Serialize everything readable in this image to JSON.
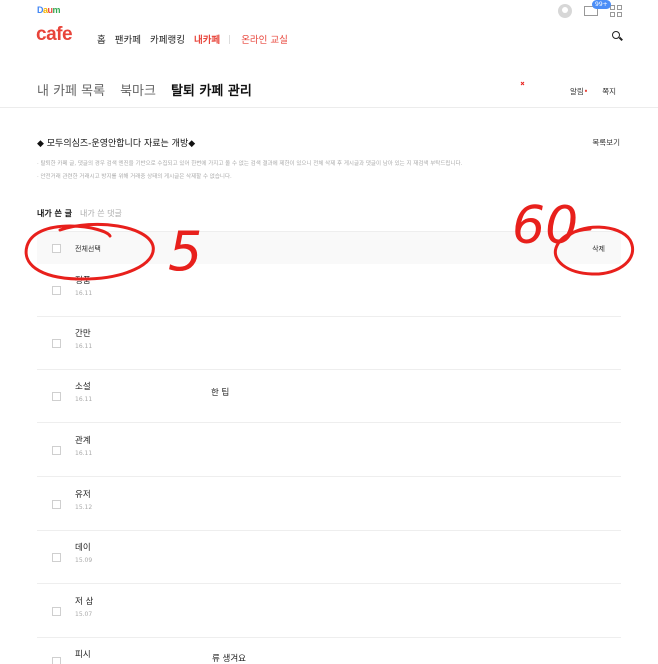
{
  "header": {
    "daum_letters": [
      "D",
      "a",
      "u",
      "m"
    ],
    "cafe_logo": "cafe",
    "mail_badge": "99+",
    "nav": [
      "홈",
      "팬카페",
      "카페랭킹",
      "내카페",
      "온라인 교실"
    ]
  },
  "tabs": [
    "내 카페 목록",
    "북마크",
    "탈퇴 카페 관리"
  ],
  "tab_right": {
    "alarm": "알림",
    "alarm_dot": "•",
    "note": "쪽지"
  },
  "cafe": {
    "title": "◆ 모두의심즈-운영안합니다 자료는 개방◆",
    "list_view": "목록보기",
    "notices": [
      "· 탈퇴한 카페 글, 댓글의 경우 검색 엔진을 기반으로 수집되고 있어 한번에 가지고 올 수 없는 검색 결과에 제한이 있으니 전체 삭제 후 게시글과 댓글이 남아 있는 지 재검색 부탁드립니다.",
      "· 안전거래 관련한 거래시고 방지를 위해 거래중 상태의 게시글은 삭제할 수 없습니다."
    ]
  },
  "subtabs": {
    "posts": "내가 쓴 글",
    "comments": "내가 쓴 댓글"
  },
  "table": {
    "select_all": "전체선택",
    "delete": "삭제",
    "rows": [
      {
        "title": "정품",
        "date": "16.11"
      },
      {
        "title": "간만",
        "date": "16.11"
      },
      {
        "title": "소설",
        "date": "16.11",
        "extra": "한 팁"
      },
      {
        "title": "관계",
        "date": "16.11"
      },
      {
        "title": "유저",
        "date": "15.12"
      },
      {
        "title": "데이",
        "date": "15.09"
      },
      {
        "title": "저 삼",
        "date": "15.07"
      },
      {
        "title": "피시",
        "date": "",
        "extra": "류 생겨요"
      }
    ]
  },
  "annotations": [
    "5",
    "60"
  ],
  "colors": {
    "brand": "#e8443a",
    "badge": "#4c8ef7",
    "scribble": "#e8201c"
  }
}
